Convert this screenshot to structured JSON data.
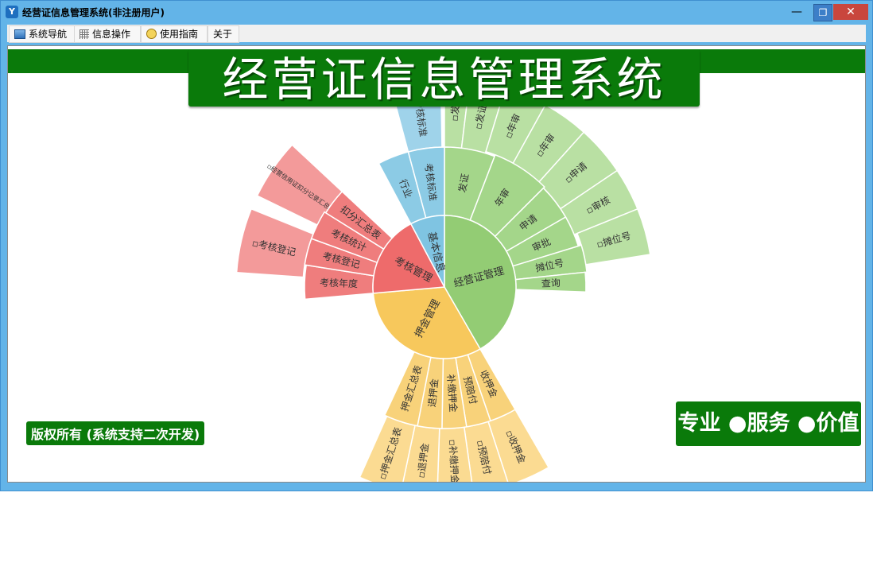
{
  "window": {
    "title": "经营证信息管理系统(非注册用户)",
    "min_glyph": "—",
    "max_glyph": "❐",
    "close_glyph": "✕"
  },
  "menu": {
    "items": [
      {
        "label": "系统导航",
        "icon": "nav-icon"
      },
      {
        "label": "信息操作",
        "icon": "grid-icon"
      },
      {
        "label": "使用指南",
        "icon": "help-icon"
      },
      {
        "label": "关于",
        "icon": ""
      }
    ]
  },
  "header": {
    "title": "经营证信息管理系统"
  },
  "footer": {
    "copyright": "版权所有 (系统支持二次开发)",
    "slogan": "专业 ●服务 ●价值"
  },
  "colors": {
    "green_brand": "#0a7a0a",
    "inner_green": "#93cc74",
    "inner_red": "#ee6b6b",
    "inner_yellow": "#f7c85c",
    "inner_blue": "#7fc4e2"
  },
  "sunburst": {
    "inner": [
      {
        "label": "经营证管理",
        "color": "#93cc74"
      },
      {
        "label": "押金管理",
        "color": "#f7c85c"
      },
      {
        "label": "考核管理",
        "color": "#ee6b6b"
      },
      {
        "label": "基本信息",
        "color": "#7fc4e2"
      }
    ],
    "middle": [
      {
        "label": "发证",
        "color": "#a4d68a"
      },
      {
        "label": "年审",
        "color": "#a4d68a"
      },
      {
        "label": "申请",
        "color": "#a4d68a"
      },
      {
        "label": "审批",
        "color": "#a4d68a"
      },
      {
        "label": "摊位号",
        "color": "#a4d68a"
      },
      {
        "label": "查询",
        "color": "#a4d68a"
      },
      {
        "label": "收押金",
        "color": "#f8d27a"
      },
      {
        "label": "预赔付",
        "color": "#f8d27a"
      },
      {
        "label": "补缴押金",
        "color": "#f8d27a"
      },
      {
        "label": "退押金",
        "color": "#f8d27a"
      },
      {
        "label": "押金汇总表",
        "color": "#f8d27a"
      },
      {
        "label": "考核年度",
        "color": "#ef7d7d"
      },
      {
        "label": "考核登记",
        "color": "#ef7d7d"
      },
      {
        "label": "考核统计",
        "color": "#ef7d7d"
      },
      {
        "label": "扣分汇总表",
        "color": "#ef7d7d"
      },
      {
        "label": "行业",
        "color": "#8ccbe5"
      },
      {
        "label": "考核标准",
        "color": "#8ccbe5"
      }
    ],
    "outer": [
      {
        "label": "▫发",
        "color": "#b9e0a3"
      },
      {
        "label": "▫发证",
        "color": "#b9e0a3"
      },
      {
        "label": "▫年审",
        "color": "#b9e0a3"
      },
      {
        "label": "▫年审",
        "color": "#b9e0a3"
      },
      {
        "label": "▫申请",
        "color": "#b9e0a3"
      },
      {
        "label": "▫审核",
        "color": "#b9e0a3"
      },
      {
        "label": "▫摊位号",
        "color": "#b9e0a3"
      },
      {
        "label": "▫收押金",
        "color": "#fbdb92"
      },
      {
        "label": "▫预赔付",
        "color": "#fbdb92"
      },
      {
        "label": "▫补缴押金",
        "color": "#fbdb92"
      },
      {
        "label": "▫退押金",
        "color": "#fbdb92"
      },
      {
        "label": "▫押金汇总表",
        "color": "#fbdb92"
      },
      {
        "label": "▫考核登记",
        "color": "#f39a9a"
      },
      {
        "label": "▫经营信用证扣分记录汇总表",
        "color": "#f39a9a"
      },
      {
        "label": "▫考核标准",
        "color": "#9fd3ea"
      }
    ]
  }
}
